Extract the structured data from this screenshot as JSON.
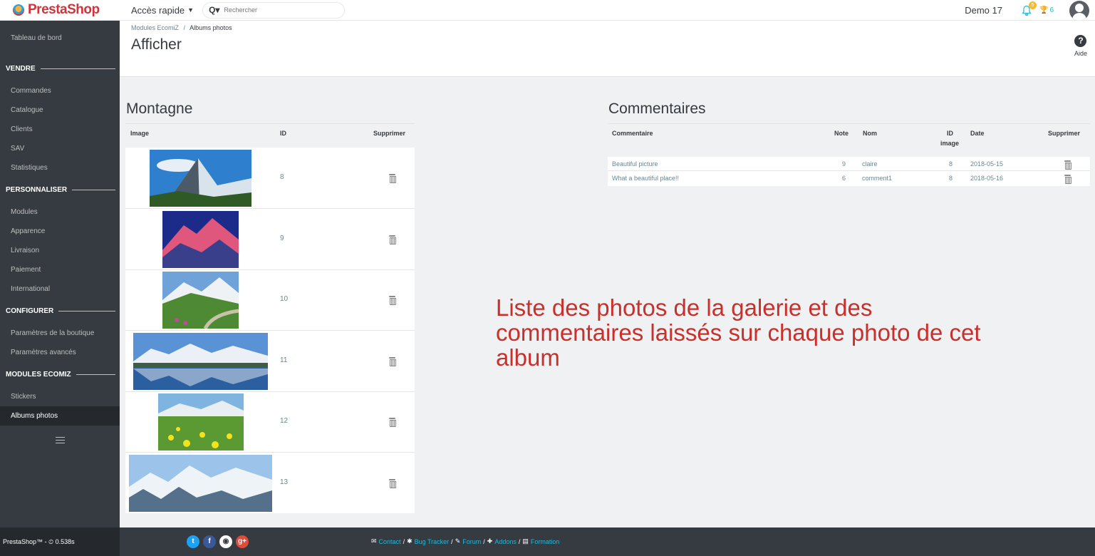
{
  "header": {
    "logo_text": "PrestaShop",
    "quick_access": "Accès rapide",
    "search_placeholder": "Rechercher",
    "user_name": "Demo 17",
    "notification_count": "5",
    "trophy_count": "6"
  },
  "sidebar": {
    "dashboard": "Tableau de bord",
    "sections": [
      {
        "title": "VENDRE",
        "items": [
          "Commandes",
          "Catalogue",
          "Clients",
          "SAV",
          "Statistiques"
        ]
      },
      {
        "title": "PERSONNALISER",
        "items": [
          "Modules",
          "Apparence",
          "Livraison",
          "Paiement",
          "International"
        ]
      },
      {
        "title": "CONFIGURER",
        "items": [
          "Paramètres de la boutique",
          "Paramètres avancés"
        ]
      },
      {
        "title": "MODULES ECOMIZ",
        "items": [
          "Stickers",
          "Albums photos"
        ]
      }
    ],
    "active_item": "Albums photos"
  },
  "page": {
    "breadcrumb_parent": "Modules EcomiZ",
    "breadcrumb_sep": "/",
    "breadcrumb_current": "Albums photos",
    "title": "Afficher",
    "help_label": "Aide"
  },
  "album": {
    "title": "Montagne",
    "columns": {
      "image": "Image",
      "id": "ID",
      "delete": "Supprimer"
    },
    "photos": [
      {
        "id": "8",
        "thumb": "peak"
      },
      {
        "id": "9",
        "thumb": "sunset"
      },
      {
        "id": "10",
        "thumb": "valley"
      },
      {
        "id": "11",
        "thumb": "lake"
      },
      {
        "id": "12",
        "thumb": "meadow"
      },
      {
        "id": "13",
        "thumb": "snow"
      }
    ]
  },
  "comments": {
    "title": "Commentaires",
    "columns": {
      "comment": "Commentaire",
      "note": "Note",
      "name": "Nom",
      "id_image_1": "ID",
      "id_image_2": "image",
      "date": "Date",
      "delete": "Supprimer"
    },
    "rows": [
      {
        "comment": "Beautiful picture",
        "note": "9",
        "name": "claire",
        "id_image": "8",
        "date": "2018-05-15"
      },
      {
        "comment": "What a beautiful place!!",
        "note": "6",
        "name": "comment1",
        "id_image": "8",
        "date": "2018-05-16"
      }
    ]
  },
  "annotation": "Liste des photos de la galerie et des commentaires laissés sur chaque photo de cet album",
  "footer": {
    "brand": "PrestaShop™ - ",
    "timer": "0.538s",
    "links": [
      "Contact",
      "Bug Tracker",
      "Forum",
      "Addons",
      "Formation"
    ],
    "separator": "/"
  },
  "colors": {
    "sidebar_bg": "#363a41",
    "accent": "#25b9d7",
    "brand_red": "#d0333c",
    "annotation_red": "#c9302c",
    "notification_badge": "#fbbb22"
  }
}
